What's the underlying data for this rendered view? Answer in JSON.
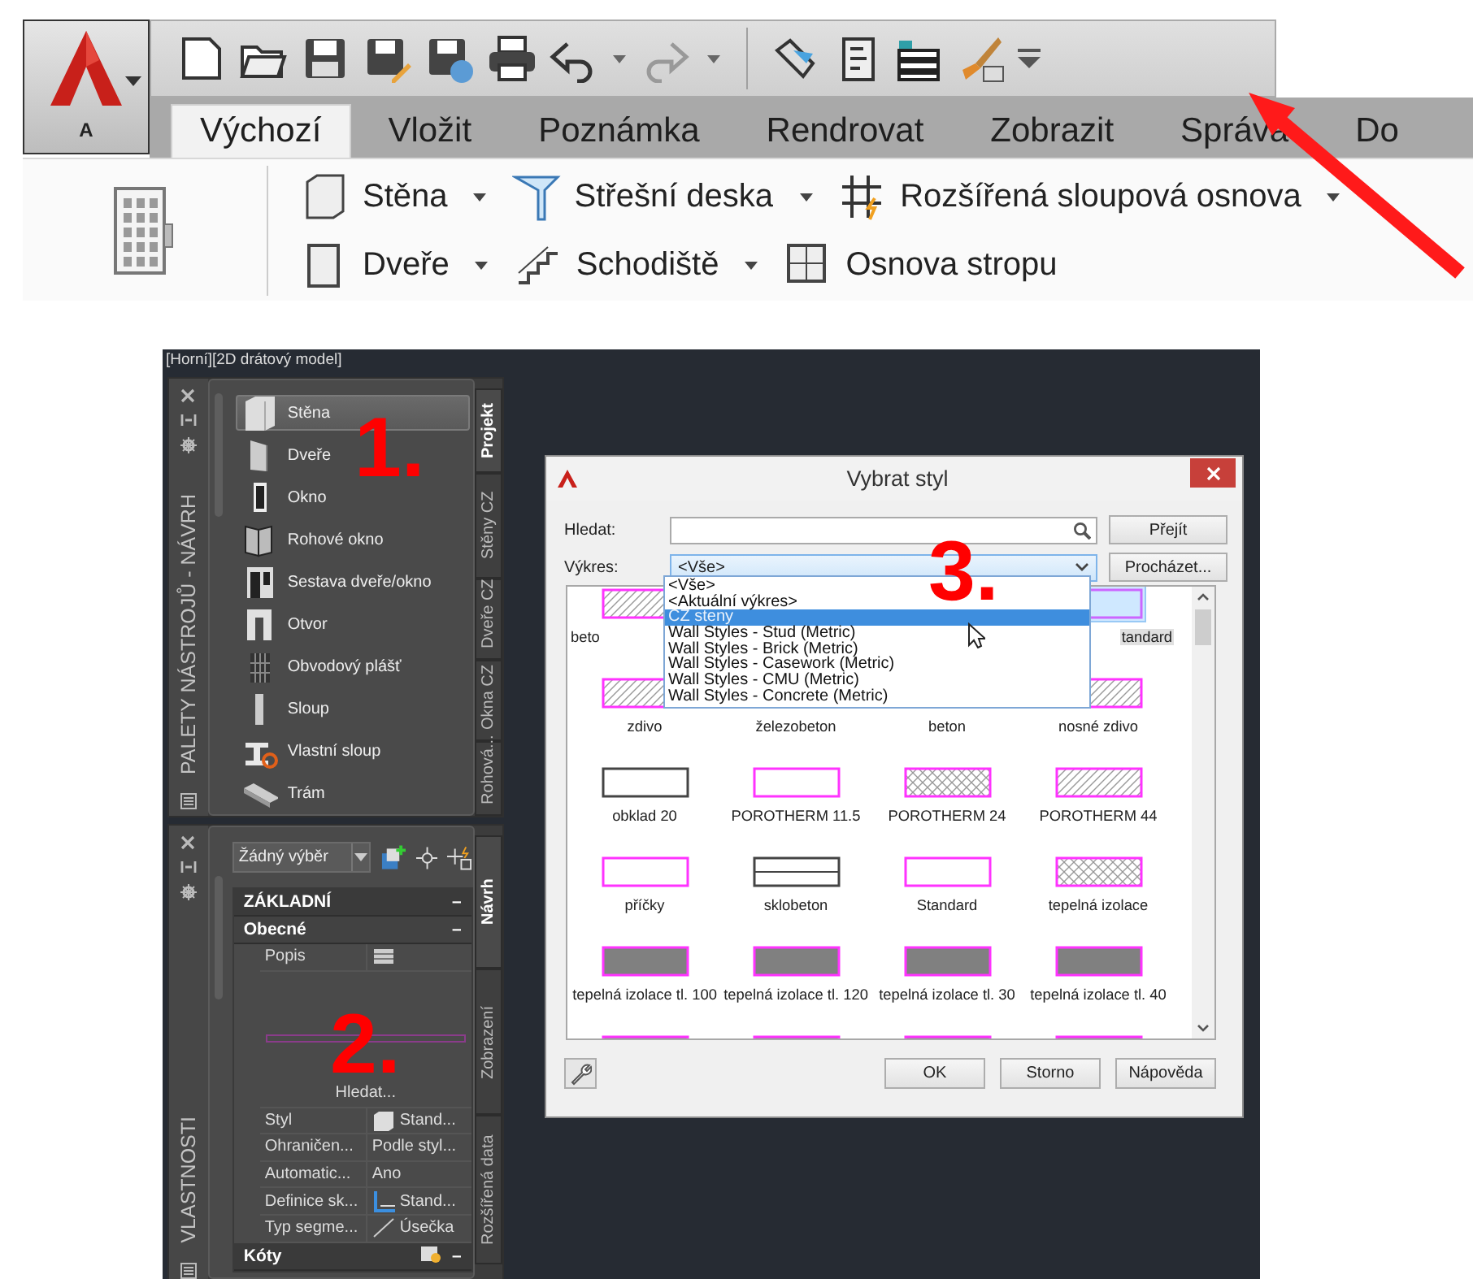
{
  "ribbon": {
    "app_button_label": "A",
    "tabs": [
      {
        "label": "Výchozí",
        "selected": true
      },
      {
        "label": "Vložit",
        "selected": false
      },
      {
        "label": "Poznámka",
        "selected": false
      },
      {
        "label": "Rendrovat",
        "selected": false
      },
      {
        "label": "Zobrazit",
        "selected": false
      },
      {
        "label": "Správa",
        "selected": false
      },
      {
        "label": "Do",
        "selected": false
      }
    ],
    "tool_rows": [
      [
        {
          "label": "Stěna",
          "dropdown": true
        },
        {
          "label": "Střešní deska",
          "dropdown": true
        },
        {
          "label": "Rozšířená sloupová osnova",
          "dropdown": true
        }
      ],
      [
        {
          "label": "Dveře",
          "dropdown": true
        },
        {
          "label": "Schodiště",
          "dropdown": true
        },
        {
          "label": "Osnova stropu",
          "dropdown": false
        }
      ]
    ]
  },
  "viewport_label": "[Horní][2D drátový model]",
  "tool_palette": {
    "title": "PALETY NÁSTROJŮ - NÁVRH",
    "items": [
      {
        "label": "Stěna",
        "selected": true
      },
      {
        "label": "Dveře",
        "selected": false
      },
      {
        "label": "Okno",
        "selected": false
      },
      {
        "label": "Rohové okno",
        "selected": false
      },
      {
        "label": "Sestava dveře/okno",
        "selected": false
      },
      {
        "label": "Otvor",
        "selected": false
      },
      {
        "label": "Obvodový plášť",
        "selected": false
      },
      {
        "label": "Sloup",
        "selected": false
      },
      {
        "label": "Vlastní sloup",
        "selected": false
      },
      {
        "label": "Trám",
        "selected": false
      }
    ],
    "tabs": [
      {
        "label": "Projekt",
        "selected": true
      },
      {
        "label": "Stěny CZ",
        "selected": false
      },
      {
        "label": "Dveře CZ",
        "selected": false
      },
      {
        "label": "Okna CZ",
        "selected": false
      },
      {
        "label": "Rohová...",
        "selected": false
      }
    ]
  },
  "properties": {
    "title": "VLASTNOSTI",
    "selection": "Žádný výběr",
    "rows": [
      {
        "kind": "header",
        "label": "ZÁKLADNÍ",
        "toggle": "–"
      },
      {
        "kind": "subheader",
        "label": "Obecné",
        "toggle": "–"
      },
      {
        "kind": "property",
        "name": "Popis"
      },
      {
        "kind": "preview",
        "label": "Hledat..."
      },
      {
        "kind": "property",
        "name": "Styl",
        "value": "Stand..."
      },
      {
        "kind": "property",
        "name": "Ohraničen...",
        "value": "Podle styl..."
      },
      {
        "kind": "property",
        "name": "Automatic...",
        "value": "Ano"
      },
      {
        "kind": "property",
        "name": "Definice sk...",
        "value": "Stand..."
      },
      {
        "kind": "property",
        "name": "Typ segme...",
        "value": "Úsečka"
      },
      {
        "kind": "header",
        "label": "Kóty",
        "toggle": "–"
      }
    ],
    "tabs": [
      {
        "label": "Návrh",
        "selected": true
      },
      {
        "label": "Zobrazení",
        "selected": false
      },
      {
        "label": "Rozšířená data",
        "selected": false
      }
    ]
  },
  "dialog": {
    "title": "Vybrat styl",
    "search_label": "Hledat:",
    "go_button": "Přejít",
    "drawing_label": "Výkres:",
    "drawing_value": "<Vše>",
    "browse_button": "Procházet...",
    "options": [
      {
        "label": "<Vše>",
        "selected": false
      },
      {
        "label": "<Aktuální výkres>",
        "selected": false
      },
      {
        "label": "CZ steny",
        "selected": true
      },
      {
        "label": "Wall Styles - Stud (Metric)",
        "selected": false
      },
      {
        "label": "Wall Styles - Brick (Metric)",
        "selected": false
      },
      {
        "label": "Wall Styles - Casework (Metric)",
        "selected": false
      },
      {
        "label": "Wall Styles - CMU (Metric)",
        "selected": false
      },
      {
        "label": "Wall Styles - Concrete (Metric)",
        "selected": false
      }
    ],
    "styles": [
      {
        "kind": "hatch",
        "label": "beto",
        "color": "#ff33ff",
        "selected": false
      },
      {
        "kind": "covered"
      },
      {
        "kind": "covered"
      },
      {
        "kind": "blank",
        "label": "tandard",
        "color": "#cc66ff",
        "selected": true
      },
      {
        "kind": "hatch",
        "label": "zdivo",
        "color": "#ff33ff",
        "selected": false
      },
      {
        "kind": "label",
        "label": "železobeton",
        "selected": false
      },
      {
        "kind": "label",
        "label": "beton",
        "selected": false
      },
      {
        "kind": "hatch",
        "label": "nosné zdivo",
        "color": "#ff33ff",
        "selected": false
      },
      {
        "kind": "blank",
        "label": "obklad 20",
        "color": "#444444",
        "selected": false
      },
      {
        "kind": "blank",
        "label": "POROTHERM 11.5",
        "color": "#ff33ff",
        "selected": false
      },
      {
        "kind": "crosshatch",
        "label": "POROTHERM 24",
        "color": "#ff33ff",
        "selected": false
      },
      {
        "kind": "hatch",
        "label": "POROTHERM 44",
        "color": "#ff33ff",
        "selected": false
      },
      {
        "kind": "blank",
        "label": "příčky",
        "color": "#ff33ff",
        "selected": false
      },
      {
        "kind": "double",
        "label": "sklobeton",
        "color": "#444444",
        "selected": false
      },
      {
        "kind": "blank",
        "label": "Standard",
        "color": "#ff33ff",
        "selected": false
      },
      {
        "kind": "crosshatch",
        "label": "tepelná izolace",
        "color": "#ff33ff",
        "selected": false
      },
      {
        "kind": "solid",
        "label": "tepelná izolace tl. 100",
        "color": "#ff33ff",
        "selected": false
      },
      {
        "kind": "solid",
        "label": "tepelná izolace tl. 120",
        "color": "#ff33ff",
        "selected": false
      },
      {
        "kind": "solid",
        "label": "tepelná izolace tl. 30",
        "color": "#ff33ff",
        "selected": false
      },
      {
        "kind": "solid",
        "label": "tepelná izolace tl. 40",
        "color": "#ff33ff",
        "selected": false
      },
      {
        "kind": "solid",
        "color": "#ff33ff",
        "selected": false
      },
      {
        "kind": "solid",
        "color": "#ff33ff",
        "selected": false
      },
      {
        "kind": "solid",
        "color": "#ff33ff",
        "selected": false
      },
      {
        "kind": "solid",
        "color": "#ff33ff",
        "selected": false
      }
    ],
    "buttons": [
      "OK",
      "Storno",
      "Nápověda"
    ]
  },
  "annotations": [
    {
      "label": "1."
    },
    {
      "label": "2."
    },
    {
      "label": "3."
    }
  ]
}
